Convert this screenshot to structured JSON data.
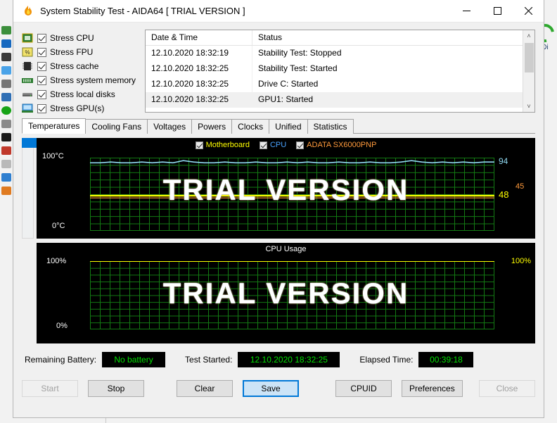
{
  "window": {
    "title": "System Stability Test - AIDA64  [ TRIAL VERSION ]",
    "app_icon": "aida64-flame-icon",
    "minimize": "—",
    "maximize": "□",
    "close": "✕"
  },
  "desktop": {
    "recycle_label": "Di",
    "recycle_icon": "recycle-bin-icon"
  },
  "stress_options": [
    {
      "label": "Stress CPU",
      "checked": true,
      "icon": "cpu-chip-icon"
    },
    {
      "label": "Stress FPU",
      "checked": true,
      "icon": "fpu-chip-icon"
    },
    {
      "label": "Stress cache",
      "checked": true,
      "icon": "cache-chip-icon"
    },
    {
      "label": "Stress system memory",
      "checked": true,
      "icon": "memory-module-icon"
    },
    {
      "label": "Stress local disks",
      "checked": true,
      "icon": "hard-disk-icon"
    },
    {
      "label": "Stress GPU(s)",
      "checked": true,
      "icon": "gpu-monitor-icon"
    }
  ],
  "log": {
    "columns": [
      "Date & Time",
      "Status"
    ],
    "rows": [
      {
        "datetime": "12.10.2020 18:32:19",
        "status": "Stability Test: Stopped"
      },
      {
        "datetime": "12.10.2020 18:32:25",
        "status": "Stability Test: Started"
      },
      {
        "datetime": "12.10.2020 18:32:25",
        "status": "Drive C: Started"
      },
      {
        "datetime": "12.10.2020 18:32:25",
        "status": "GPU1: Started"
      }
    ],
    "scroll_up": "˄",
    "scroll_down": "˅"
  },
  "tabs": [
    {
      "label": "Temperatures",
      "active": true
    },
    {
      "label": "Cooling Fans",
      "active": false
    },
    {
      "label": "Voltages",
      "active": false
    },
    {
      "label": "Powers",
      "active": false
    },
    {
      "label": "Clocks",
      "active": false
    },
    {
      "label": "Unified",
      "active": false
    },
    {
      "label": "Statistics",
      "active": false
    }
  ],
  "watermark": "TRIAL VERSION",
  "chart_data": [
    {
      "type": "line",
      "name": "temperatures-chart",
      "title": "",
      "ylabel_top": "100°C",
      "ylabel_bottom": "0°C",
      "ylim": [
        0,
        100
      ],
      "grid": true,
      "legend_position": "top-center",
      "series": [
        {
          "name": "Motherboard",
          "color": "#ffff00",
          "current": 48,
          "current_label": "48",
          "values": [
            48,
            48,
            48,
            48,
            48,
            48,
            48,
            48,
            48,
            48,
            48,
            48,
            48,
            48,
            48,
            48,
            48,
            48,
            48,
            48,
            48,
            48,
            48,
            48,
            48,
            48,
            48,
            48,
            48,
            48,
            48,
            48,
            48,
            48,
            48,
            48,
            48,
            48,
            48,
            48
          ]
        },
        {
          "name": "CPU",
          "color": "#8fd8f0",
          "current": 94,
          "current_label": "94",
          "values": [
            93,
            93,
            94,
            93,
            93,
            94,
            93,
            94,
            93,
            96,
            94,
            93,
            93,
            94,
            93,
            93,
            94,
            93,
            93,
            94,
            93,
            94,
            93,
            93,
            94,
            93,
            93,
            94,
            93,
            93,
            94,
            96,
            94,
            93,
            94,
            93,
            94,
            93,
            94,
            94
          ]
        },
        {
          "name": "ADATA SX6000PNP",
          "color": "#ff9a3c",
          "current": 45,
          "current_label": "45",
          "values": [
            45,
            45,
            45,
            45,
            45,
            45,
            45,
            45,
            45,
            45,
            45,
            45,
            45,
            45,
            45,
            45,
            45,
            45,
            45,
            45,
            45,
            45,
            45,
            45,
            45,
            45,
            45,
            45,
            45,
            45,
            45,
            45,
            45,
            45,
            45,
            45,
            45,
            45,
            45,
            45
          ]
        }
      ]
    },
    {
      "type": "line",
      "name": "cpu-usage-chart",
      "title": "CPU Usage",
      "ylabel_top": "100%",
      "ylabel_bottom": "0%",
      "ylabel_right": "100%",
      "ylim": [
        0,
        100
      ],
      "grid": true,
      "series": [
        {
          "name": "CPU Usage",
          "color": "#ffff00",
          "current": 100,
          "current_label": "100%",
          "values": [
            100,
            100,
            100,
            100,
            100,
            100,
            100,
            100,
            100,
            100,
            100,
            100,
            100,
            100,
            100,
            100,
            100,
            100,
            100,
            100,
            100,
            100,
            100,
            100,
            100,
            100,
            100,
            100,
            100,
            100,
            100,
            100,
            100,
            100,
            100,
            100,
            100,
            100,
            100,
            100
          ]
        }
      ]
    }
  ],
  "status": {
    "battery_label": "Remaining Battery:",
    "battery_value": "No battery",
    "started_label": "Test Started:",
    "started_value": "12.10.2020 18:32:25",
    "elapsed_label": "Elapsed Time:",
    "elapsed_value": "00:39:18"
  },
  "buttons": {
    "start": "Start",
    "stop": "Stop",
    "clear": "Clear",
    "save": "Save",
    "cpuid": "CPUID",
    "preferences": "Preferences",
    "close": "Close"
  }
}
